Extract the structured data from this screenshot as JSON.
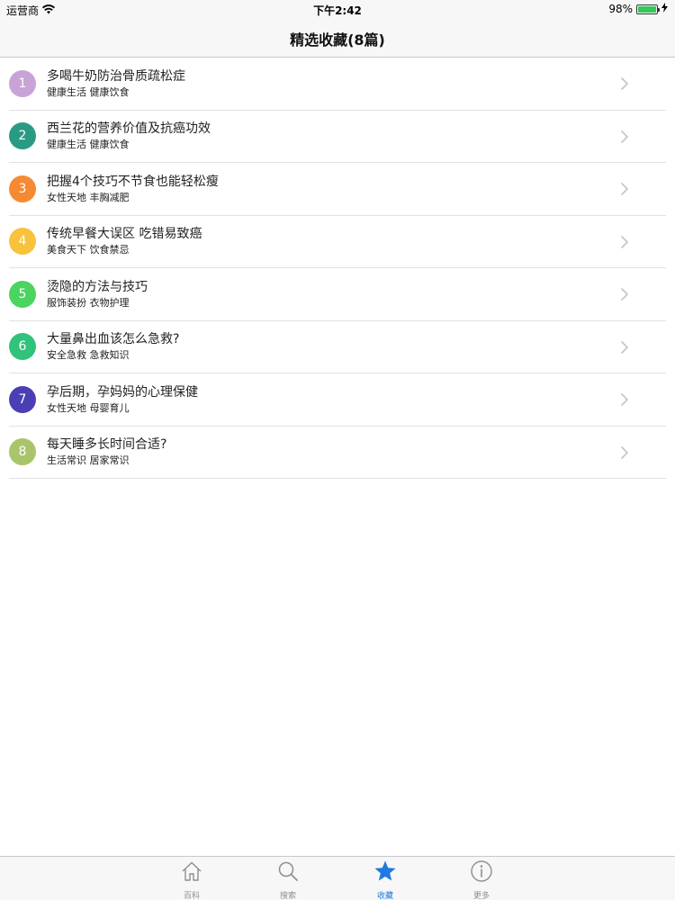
{
  "status_bar": {
    "carrier": "运营商",
    "time": "下午2:42",
    "battery_percent": "98%",
    "battery_level": 0.98
  },
  "nav": {
    "title": "精选收藏(8篇)"
  },
  "colors": {
    "accent": "#1f7ae0",
    "badges": [
      "#c9a3d6",
      "#2a9b83",
      "#f58a32",
      "#f9c23c",
      "#4cd460",
      "#31c27c",
      "#4a3fb5",
      "#a9c56a"
    ]
  },
  "list": [
    {
      "num": "1",
      "title": "多喝牛奶防治骨质疏松症",
      "sub": "健康生活 健康饮食"
    },
    {
      "num": "2",
      "title": "西兰花的营养价值及抗癌功效",
      "sub": "健康生活 健康饮食"
    },
    {
      "num": "3",
      "title": "把握4个技巧不节食也能轻松瘦",
      "sub": "女性天地 丰胸减肥"
    },
    {
      "num": "4",
      "title": "传统早餐大误区 吃错易致癌",
      "sub": "美食天下 饮食禁忌"
    },
    {
      "num": "5",
      "title": "烫隐的方法与技巧",
      "sub": "服饰装扮 衣物护理"
    },
    {
      "num": "6",
      "title": "大量鼻出血该怎么急救?",
      "sub": "安全急救 急救知识"
    },
    {
      "num": "7",
      "title": "孕后期，孕妈妈的心理保健",
      "sub": "女性天地 母婴育儿"
    },
    {
      "num": "8",
      "title": "每天睡多长时间合适?",
      "sub": "生活常识 居家常识"
    }
  ],
  "tabs": [
    {
      "label": "百科",
      "icon": "home-icon"
    },
    {
      "label": "搜索",
      "icon": "search-icon"
    },
    {
      "label": "收藏",
      "icon": "star-icon",
      "active": true
    },
    {
      "label": "更多",
      "icon": "info-icon"
    }
  ]
}
